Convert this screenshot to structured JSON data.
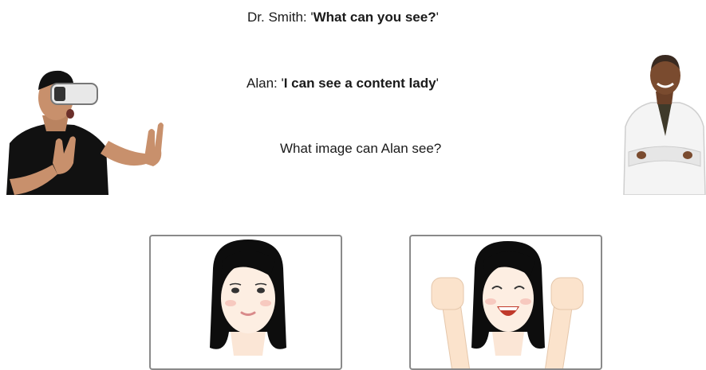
{
  "dialogue": {
    "line1_speaker": "Dr. Smith: '",
    "line1_text": "What can you see?",
    "line1_end": "'",
    "line2_speaker": "Alan: '",
    "line2_text": "I can see a content lady",
    "line2_end": "'"
  },
  "question": "What image can Alan see?",
  "options": [
    {
      "id": "content-lady"
    },
    {
      "id": "excited-lady"
    }
  ]
}
